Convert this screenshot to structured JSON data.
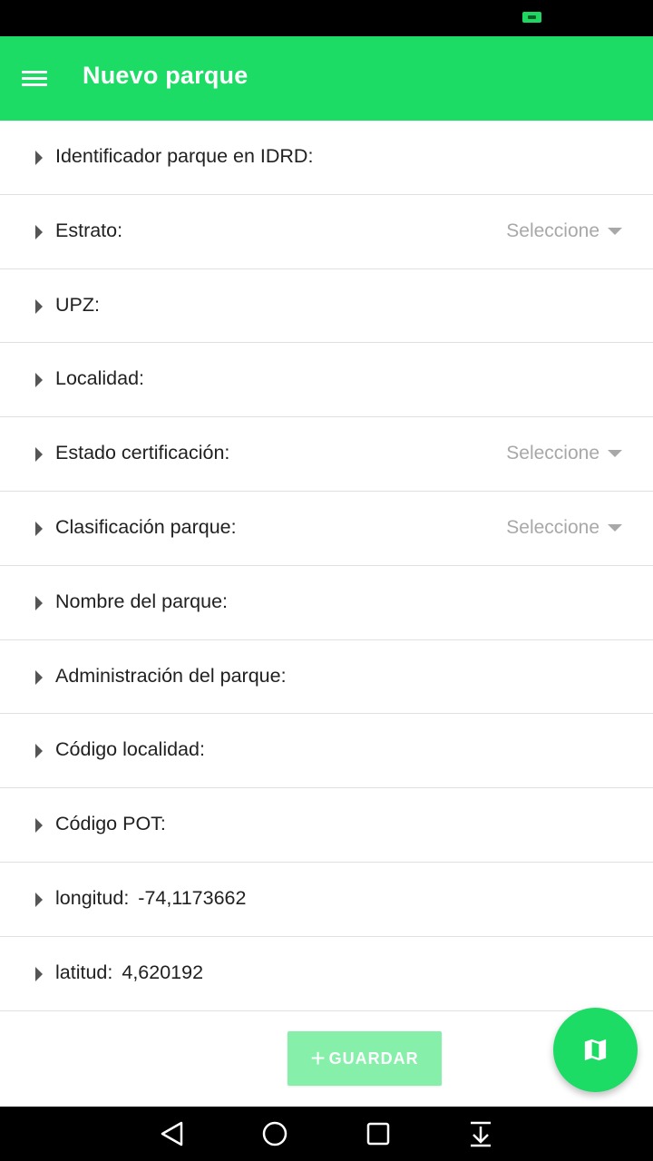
{
  "app_bar": {
    "title": "Nuevo parque",
    "color": "#1ddc66"
  },
  "icons": {
    "menu": "hamburger-menu-icon",
    "row_expand": "caret-right-icon",
    "select_arrow": "caret-down-icon",
    "add": "plus-icon",
    "fab": "map-icon",
    "nav_back": "triangle-back-icon",
    "nav_home": "circle-home-icon",
    "nav_recents": "square-recents-icon",
    "nav_notifications": "pull-down-icon"
  },
  "form": {
    "rows": [
      {
        "label": "Identificador parque en IDRD:",
        "value": ""
      },
      {
        "label": "Estrato:",
        "select": "Seleccione"
      },
      {
        "label": "UPZ:",
        "value": ""
      },
      {
        "label": "Localidad:",
        "value": ""
      },
      {
        "label": "Estado certificación:",
        "select": "Seleccione"
      },
      {
        "label": "Clasificación parque:",
        "select": "Seleccione"
      },
      {
        "label": "Nombre del parque:",
        "value": ""
      },
      {
        "label": "Administración del parque:",
        "value": ""
      },
      {
        "label": "Código localidad:",
        "value": ""
      },
      {
        "label": "Código POT:",
        "value": ""
      },
      {
        "label": "longitud:",
        "value": "-74,1173662"
      },
      {
        "label": "latitud:",
        "value": "4,620192"
      }
    ]
  },
  "actions": {
    "save_label": "GUARDAR",
    "save_color": "#86efaa"
  }
}
